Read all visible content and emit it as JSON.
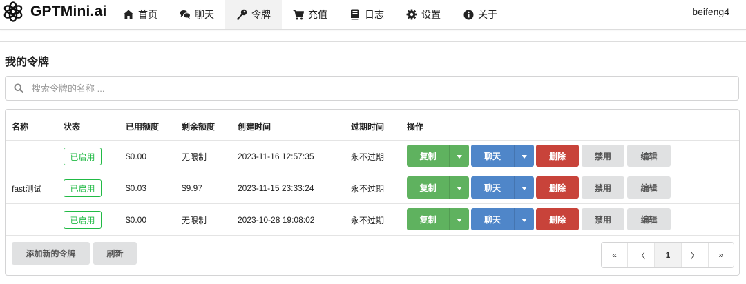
{
  "brand": {
    "name": "GPTMini.ai",
    "logo_icon": "openai-logo-icon"
  },
  "nav": [
    {
      "label": "首页",
      "icon": "home-icon"
    },
    {
      "label": "聊天",
      "icon": "chat-icon"
    },
    {
      "label": "令牌",
      "icon": "key-icon",
      "active": true
    },
    {
      "label": "充值",
      "icon": "cart-icon"
    },
    {
      "label": "日志",
      "icon": "book-icon"
    },
    {
      "label": "设置",
      "icon": "gear-icon"
    },
    {
      "label": "关于",
      "icon": "info-icon"
    }
  ],
  "user": {
    "name": "beifeng4"
  },
  "page": {
    "title": "我的令牌"
  },
  "search": {
    "placeholder": "搜索令牌的名称 ...",
    "value": ""
  },
  "table": {
    "headers": [
      "名称",
      "状态",
      "已用额度",
      "剩余额度",
      "创建时间",
      "过期时间",
      "操作"
    ],
    "rows": [
      {
        "name": "",
        "status": "已启用",
        "used": "$0.00",
        "remaining": "无限制",
        "created": "2023-11-16 12:57:35",
        "expires": "永不过期"
      },
      {
        "name": "fast测试",
        "status": "已启用",
        "used": "$0.03",
        "remaining": "$9.97",
        "created": "2023-11-15 23:33:24",
        "expires": "永不过期"
      },
      {
        "name": "",
        "status": "已启用",
        "used": "$0.00",
        "remaining": "无限制",
        "created": "2023-10-28 19:08:02",
        "expires": "永不过期"
      }
    ],
    "actions": {
      "copy": "复制",
      "chat": "聊天",
      "delete": "删除",
      "disable": "禁用",
      "edit": "编辑"
    }
  },
  "footer": {
    "add_label": "添加新的令牌",
    "refresh_label": "刷新"
  },
  "pagination": {
    "first": "«",
    "prev": "〈",
    "current": "1",
    "next": "〉",
    "last": "»"
  },
  "colors": {
    "green": "#5fb25f",
    "blue": "#4f86c9",
    "red": "#c8433a",
    "grey": "#e0e1e2",
    "badge": "#21ba45"
  }
}
